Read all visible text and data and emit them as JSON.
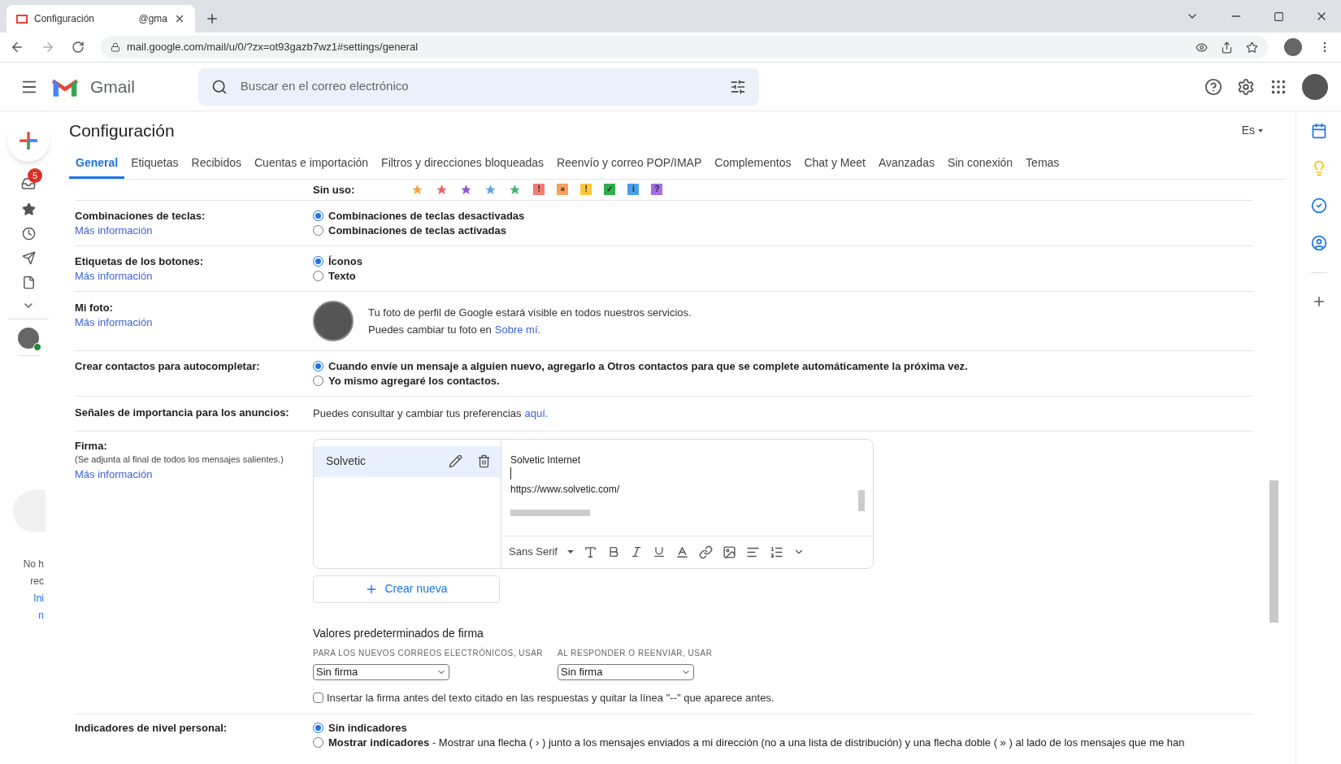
{
  "browser": {
    "tab_title": "Configuración",
    "tab_title_rest": "@gma",
    "url": "mail.google.com/mail/u/0/?zx=ot93gazb7wz1#settings/general"
  },
  "header": {
    "logo": "Gmail",
    "search_placeholder": "Buscar en el correo electrónico"
  },
  "rail": {
    "inbox_badge": "5",
    "notice_lines": [
      {
        "text": "No h",
        "link": false
      },
      {
        "text": "rec",
        "link": false
      },
      {
        "text": "Ini",
        "link": true
      },
      {
        "text": "n",
        "link": true
      }
    ]
  },
  "page": {
    "title": "Configuración",
    "language": "Es"
  },
  "tabs": [
    {
      "label": "General",
      "selected": true
    },
    {
      "label": "Etiquetas",
      "selected": false
    },
    {
      "label": "Recibidos",
      "selected": false
    },
    {
      "label": "Cuentas e importación",
      "selected": false
    },
    {
      "label": "Filtros y direcciones bloqueadas",
      "selected": false
    },
    {
      "label": "Reenvío y correo POP/IMAP",
      "selected": false
    },
    {
      "label": "Complementos",
      "selected": false
    },
    {
      "label": "Chat y Meet",
      "selected": false
    },
    {
      "label": "Avanzadas",
      "selected": false
    },
    {
      "label": "Sin conexión",
      "selected": false
    },
    {
      "label": "Temas",
      "selected": false
    }
  ],
  "unused_markers": {
    "label": "Sin uso:",
    "items": [
      {
        "kind": "star",
        "color": "#f2a33a"
      },
      {
        "kind": "star",
        "color": "#e8626a"
      },
      {
        "kind": "star",
        "color": "#9a51d4"
      },
      {
        "kind": "star",
        "color": "#5aa6f0"
      },
      {
        "kind": "star",
        "color": "#3fb46b"
      },
      {
        "kind": "tag",
        "color": "#f27b72",
        "symbol": "!"
      },
      {
        "kind": "tag",
        "color": "#f7a25c",
        "symbol": "»"
      },
      {
        "kind": "tag",
        "color": "#fbc935",
        "symbol": "!"
      },
      {
        "kind": "tag",
        "color": "#2eae4d",
        "symbol": "✓"
      },
      {
        "kind": "tag",
        "color": "#4a9fe8",
        "symbol": "i"
      },
      {
        "kind": "tag",
        "color": "#a66ee3",
        "symbol": "?"
      }
    ]
  },
  "settings": [
    {
      "kind": "radio",
      "label": "Combinaciones de teclas:",
      "link": "Más información",
      "options": [
        {
          "text": "Combinaciones de teclas desactivadas",
          "selected": true
        },
        {
          "text": "Combinaciones de teclas activadas",
          "selected": false
        }
      ]
    },
    {
      "kind": "radio",
      "label": "Etiquetas de los botones:",
      "link": "Más información",
      "options": [
        {
          "text": "Íconos",
          "selected": true
        },
        {
          "text": "Texto",
          "selected": false
        }
      ]
    },
    {
      "kind": "photo",
      "label": "Mi foto:",
      "link": "Más información",
      "line_1": "Tu foto de perfil de Google estará visible en todos nuestros servicios.",
      "line_2": "Puedes cambiar tu foto en",
      "line_2_link": "Sobre mí",
      "line_2_end": "."
    },
    {
      "kind": "radio",
      "label": "Crear contactos para autocompletar:",
      "options": [
        {
          "text": "Cuando envíe un mensaje a alguien nuevo, agregarlo a Otros contactos para que se complete automáticamente la próxima vez.",
          "selected": true
        },
        {
          "text": "Yo mismo agregaré los contactos.",
          "selected": false
        }
      ]
    },
    {
      "kind": "text",
      "label": "Señales de importancia para los anuncios:",
      "text": "Puedes consultar y cambiar tus preferencias",
      "text_link": "aquí",
      "text_end": "."
    }
  ],
  "signature": {
    "label": "Firma:",
    "note": "(Se adjunta al final de todos los mensajes salientes.)",
    "link": "Más información",
    "list": [
      {
        "name": "Solvetic",
        "selected": true
      }
    ],
    "editor_lines": [
      {
        "kind": "text",
        "text": "Solvetic Internet"
      },
      {
        "kind": "cursor"
      },
      {
        "kind": "text",
        "text": "https://www.solvetic.com/"
      }
    ],
    "font": "Sans Serif",
    "create_button": "Crear nueva",
    "defaults_title": "Valores predeterminados de firma",
    "defaults": [
      {
        "label": "PARA LOS NUEVOS CORREOS ELECTRÓNICOS, USAR",
        "value": "Sin firma"
      },
      {
        "label": "AL RESPONDER O REENVIAR, USAR",
        "value": "Sin firma"
      }
    ],
    "insert_before": {
      "text": "Insertar la firma antes del texto citado en las respuestas y quitar la línea \"--\" que aparece antes.",
      "checked": false
    }
  },
  "indicators": {
    "label": "Indicadores de nivel personal:",
    "options": [
      {
        "text": "**Sin indicadores**",
        "selected": true
      },
      {
        "text": "**Mostrar indicadores** - Mostrar una flecha ( › ) junto a los mensajes enviados a mi dirección (no a una lista de distribución) y una flecha doble ( » ) al lado de los mensajes que me han",
        "selected": false
      }
    ]
  }
}
